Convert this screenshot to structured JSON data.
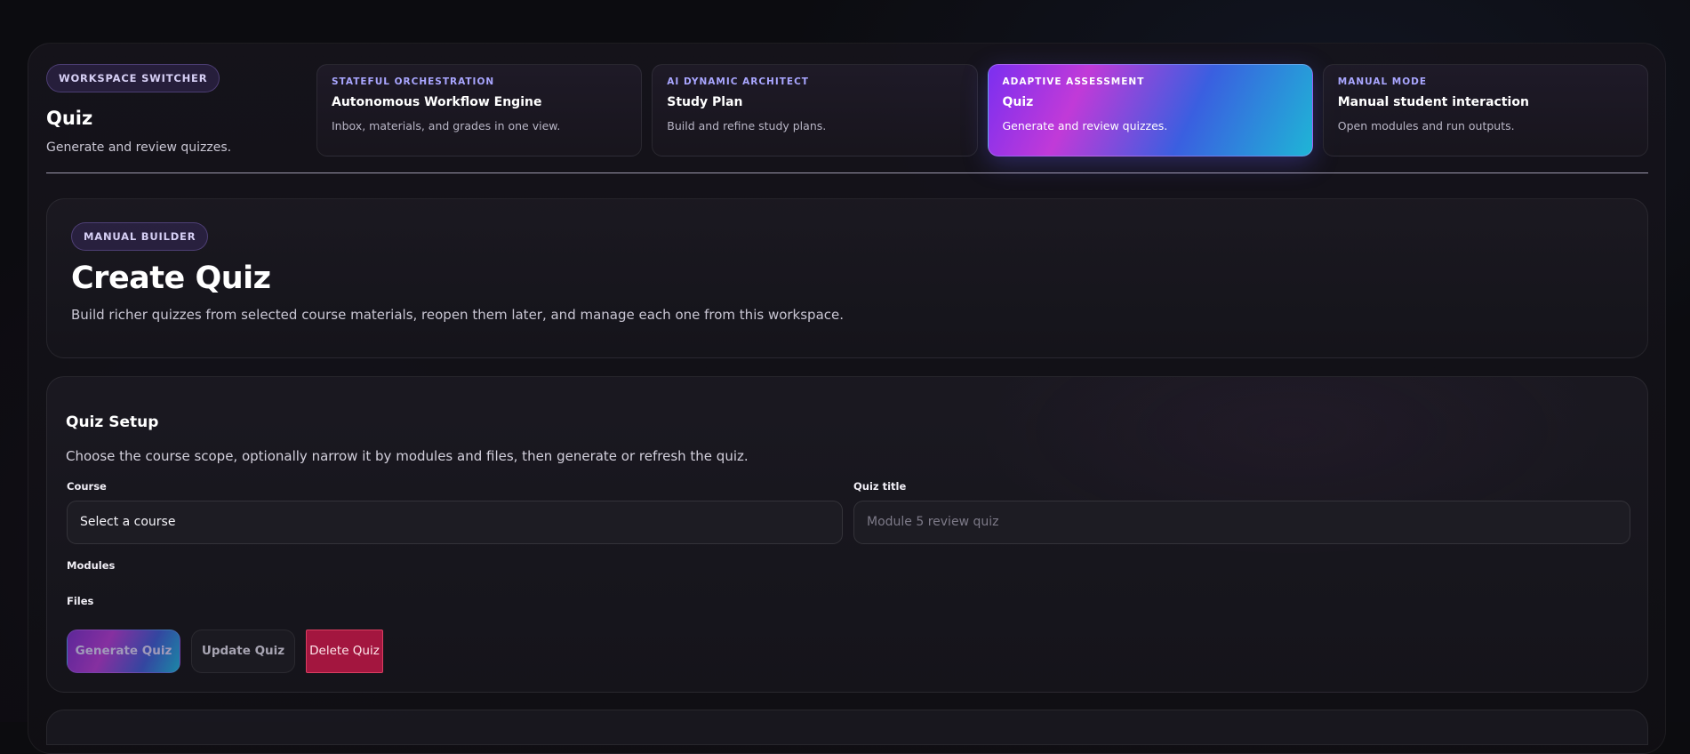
{
  "switcher": {
    "badge": "WORKSPACE SWITCHER",
    "title": "Quiz",
    "subtitle": "Generate and review quizzes."
  },
  "modes": [
    {
      "eyebrow": "STATEFUL ORCHESTRATION",
      "name": "Autonomous Workflow Engine",
      "desc": "Inbox, materials, and grades in one view."
    },
    {
      "eyebrow": "AI DYNAMIC ARCHITECT",
      "name": "Study Plan",
      "desc": "Build and refine study plans."
    },
    {
      "eyebrow": "ADAPTIVE ASSESSMENT",
      "name": "Quiz",
      "desc": "Generate and review quizzes."
    },
    {
      "eyebrow": "MANUAL MODE",
      "name": "Manual student interaction",
      "desc": "Open modules and run outputs."
    }
  ],
  "active_mode": "Quiz",
  "hero": {
    "badge": "MANUAL BUILDER",
    "title": "Create Quiz",
    "subtitle": "Build richer quizzes from selected course materials, reopen them later, and manage each one from this workspace."
  },
  "setup": {
    "title": "Quiz Setup",
    "subtitle": "Choose the course scope, optionally narrow it by modules and files, then generate or refresh the quiz.",
    "course_label": "Course",
    "course_value": "Select a course",
    "quiz_title_label": "Quiz title",
    "quiz_title_placeholder": "Module 5 review quiz",
    "modules_label": "Modules",
    "files_label": "Files",
    "generate_label": "Generate Quiz",
    "update_label": "Update Quiz",
    "delete_label": "Delete Quiz"
  },
  "colors": {
    "background": "#0c0c10",
    "active_gradient": [
      "#7b2ff0",
      "#c13ad8",
      "#3a5fe0",
      "#1fb5d6"
    ],
    "delete": "#a3163f",
    "accent_text": "#a9a6ff"
  }
}
